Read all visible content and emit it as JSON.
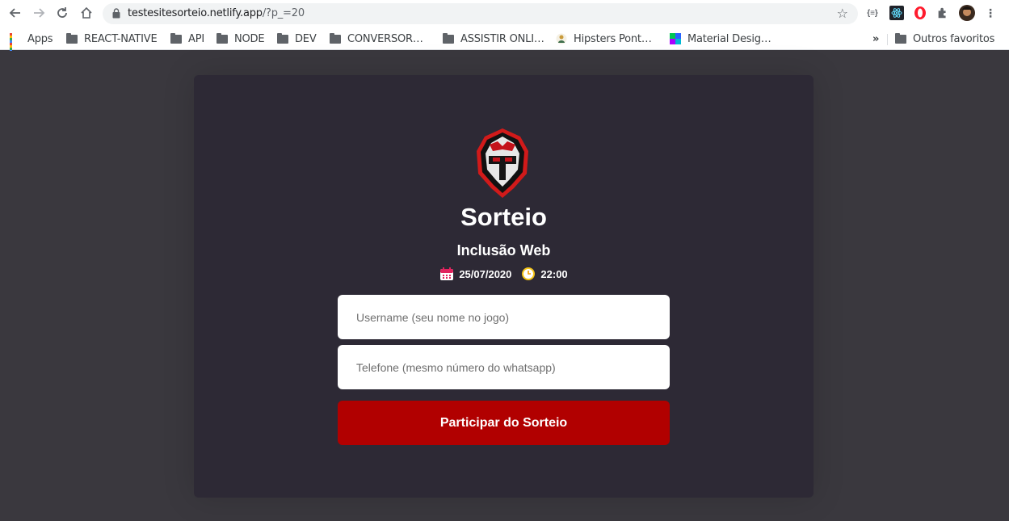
{
  "browser": {
    "url_host": "testesitesorteio.netlify.app",
    "url_path": "/?p_=20",
    "bookmarks": [
      {
        "label": "Apps",
        "icon": "apps-grid-icon"
      },
      {
        "label": "REACT-NATIVE",
        "icon": "folder-icon"
      },
      {
        "label": "API",
        "icon": "folder-icon"
      },
      {
        "label": "NODE",
        "icon": "folder-icon"
      },
      {
        "label": "DEV",
        "icon": "folder-icon"
      },
      {
        "label": "CONVERSOR…",
        "icon": "folder-icon"
      },
      {
        "label": "ASSISTIR ONLI…",
        "icon": "folder-icon"
      },
      {
        "label": "Hipsters Pont…",
        "icon": "hipsters-icon"
      },
      {
        "label": "Material Desig…",
        "icon": "material-design-icon"
      }
    ],
    "overflow_label": "»",
    "other_bookmarks": "Outros favoritos",
    "extension_label": "{≡}"
  },
  "page": {
    "title": "Sorteio",
    "subtitle": "Inclusão Web",
    "date": "25/07/2020",
    "time": "22:00",
    "username_placeholder": "Username (seu nome no jogo)",
    "phone_placeholder": "Telefone (mesmo número do whatsapp)",
    "submit_label": "Participar do Sorteio"
  },
  "colors": {
    "page_bg": "#3a383e",
    "card_bg": "#2d2935",
    "button": "#b10000",
    "brand_red": "#c4121a"
  }
}
